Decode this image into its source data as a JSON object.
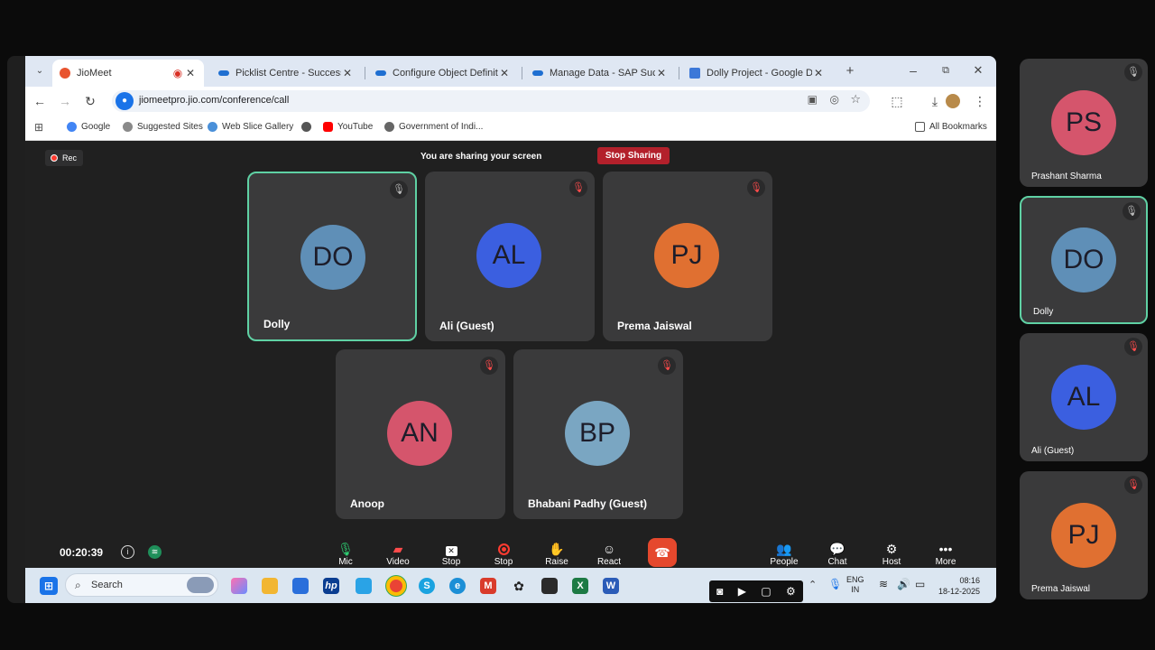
{
  "browser": {
    "tabs": [
      {
        "label": "JioMeet",
        "color": "#e8542f",
        "active": true,
        "recording": true
      },
      {
        "label": "Picklist Centre - SuccessFact",
        "color": "#1f6fd1"
      },
      {
        "label": "Configure Object Definition",
        "color": "#1f6fd1"
      },
      {
        "label": "Manage Data - SAP Success",
        "color": "#1f6fd1"
      },
      {
        "label": "Dolly Project - Google Docs",
        "color": "#3c78d8"
      }
    ],
    "url": "jiomeetpro.jio.com/conference/call",
    "bookmarks": [
      {
        "label": "Google",
        "color": "#4285f4"
      },
      {
        "label": "Suggested Sites",
        "color": "#8a8a8a"
      },
      {
        "label": "Web Slice Gallery",
        "color": "#4a90d9"
      },
      {
        "label": "",
        "color": "#555555"
      },
      {
        "label": "YouTube",
        "color": "#ff0000"
      },
      {
        "label": "Government of Indi...",
        "color": "#666666"
      }
    ],
    "all_bookmarks": "All Bookmarks"
  },
  "meeting": {
    "rec_label": "Rec",
    "sharing_text": "You are sharing your screen",
    "stop_sharing_label": "Stop Sharing",
    "timer": "00:20:39",
    "participants": [
      {
        "initials": "DO",
        "name": "Dolly",
        "color": "#5f8fb7",
        "speaking": true,
        "muted": false
      },
      {
        "initials": "AL",
        "name": "Ali (Guest)",
        "color": "#3b5fe0",
        "speaking": false,
        "muted": true
      },
      {
        "initials": "PJ",
        "name": "Prema Jaiswal",
        "color": "#e07031",
        "speaking": false,
        "muted": true
      },
      {
        "initials": "AN",
        "name": "Anoop",
        "color": "#d5556c",
        "speaking": false,
        "muted": true
      },
      {
        "initials": "BP",
        "name": "Bhabani Padhy (Guest)",
        "color": "#7aa6c2",
        "speaking": false,
        "muted": true
      }
    ],
    "controls": {
      "mic": "Mic",
      "video": "Video",
      "stop_share": "Stop",
      "stop_rec": "Stop",
      "raise": "Raise",
      "react": "React",
      "people": "People",
      "chat": "Chat",
      "host": "Host",
      "more": "More"
    }
  },
  "taskbar": {
    "search_label": "Search",
    "lang_line1": "ENG",
    "lang_line2": "IN",
    "time": "08:16",
    "date": "18-12-2025"
  },
  "side_panel": [
    {
      "initials": "PS",
      "name": "Prashant Sharma",
      "color": "#d5556c",
      "speaking": false,
      "muted": false
    },
    {
      "initials": "DO",
      "name": "Dolly",
      "color": "#5f8fb7",
      "speaking": true,
      "muted": false
    },
    {
      "initials": "AL",
      "name": "Ali (Guest)",
      "color": "#3b5fe0",
      "speaking": false,
      "muted": true
    },
    {
      "initials": "PJ",
      "name": "Prema Jaiswal",
      "color": "#e07031",
      "speaking": false,
      "muted": true
    }
  ]
}
